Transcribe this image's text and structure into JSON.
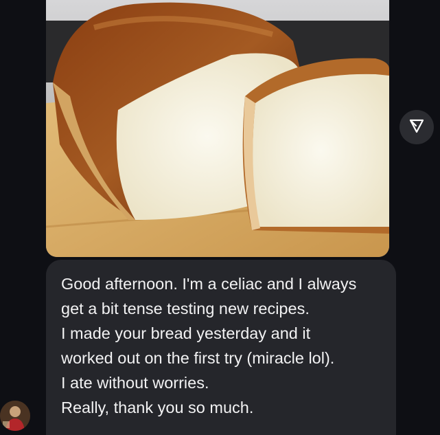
{
  "message": {
    "lines": [
      "Good afternoon. I'm a celiac and I always",
      "get a bit tense testing new recipes.",
      "I made your bread yesterday and it",
      "worked out on the first try (miracle lol).",
      "I ate without worries.",
      "Really, thank you so much."
    ]
  },
  "photo": {
    "subject": "sliced loaf of bread on a wooden board"
  },
  "icons": {
    "share": "share-icon",
    "avatar": "avatar"
  },
  "colors": {
    "background": "#0e0f14",
    "bubble": "#25262b",
    "text": "#f2f2f3"
  }
}
